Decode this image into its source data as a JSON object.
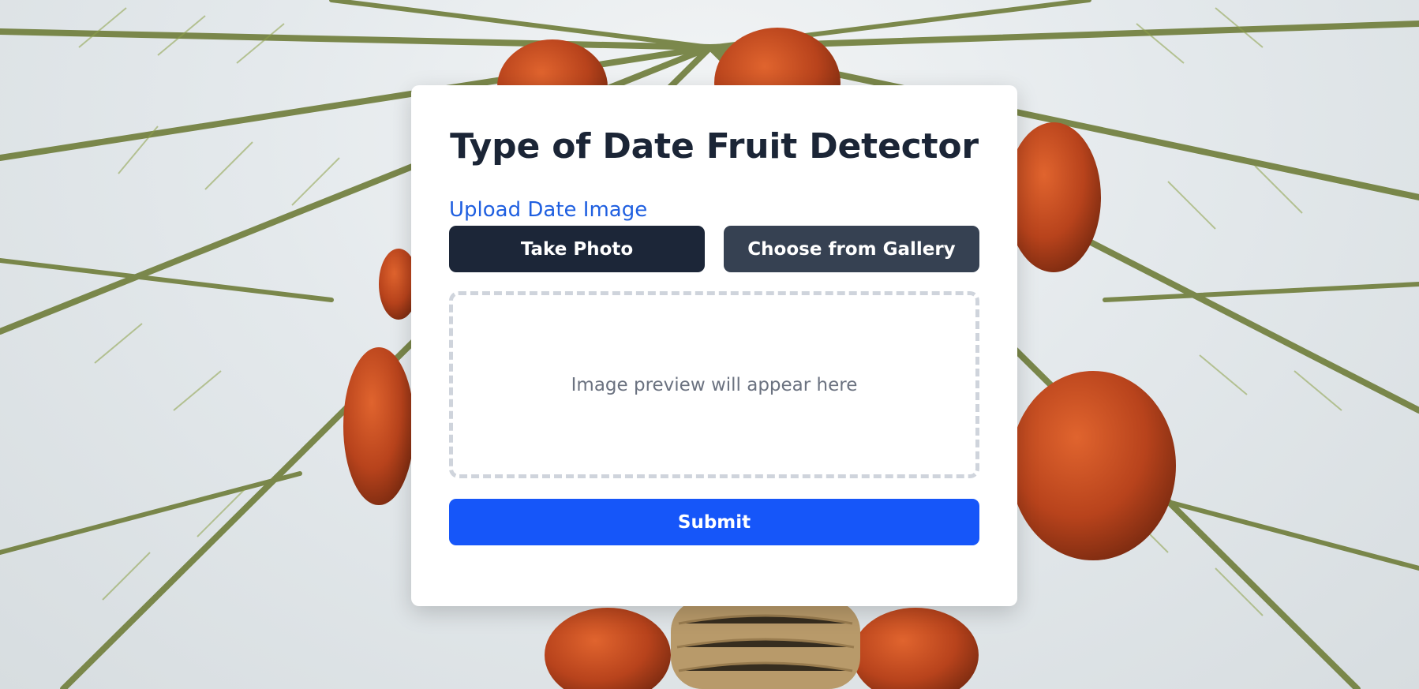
{
  "page": {
    "title": "Type of Date Fruit Detector",
    "background_image": "date-palm-tree-photo"
  },
  "upload": {
    "label": "Upload Date Image",
    "take_photo_label": "Take Photo",
    "gallery_label": "Choose from Gallery"
  },
  "preview": {
    "placeholder": "Image preview will appear here"
  },
  "submit_label": "Submit",
  "colors": {
    "title": "#1b2536",
    "label_accent": "#1f5fe0",
    "take_photo_button": "#1c2638",
    "gallery_button": "#364152",
    "submit_button": "#1656f9",
    "preview_border": "#cfd4dc"
  }
}
